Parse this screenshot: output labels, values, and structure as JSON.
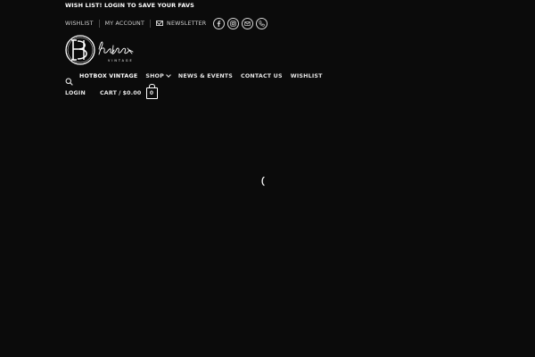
{
  "top_bar": {
    "message": "WISH LIST! LOGIN TO SAVE YOUR FAVS"
  },
  "secondary_nav": {
    "wishlist": "WISHLIST",
    "my_account": "MY ACCOUNT",
    "newsletter": "NEWSLETTER",
    "social_icons": [
      "facebook-icon",
      "instagram-icon",
      "email-icon",
      "phone-icon"
    ]
  },
  "logo": {
    "icon": "hotbox-vintage-monogram-logo"
  },
  "main_nav": {
    "items": [
      {
        "label": "HOTBOX VINTAGE"
      },
      {
        "label": "SHOP"
      },
      {
        "label": "NEWS & EVENTS"
      },
      {
        "label": "CONTACT US"
      },
      {
        "label": "WISHLIST"
      }
    ]
  },
  "account": {
    "login": "LOGIN",
    "cart_label": "CART",
    "cart_separator": "/",
    "cart_total": "$0.00",
    "cart_count": "0"
  },
  "colors": {
    "background": "#0b0b0b",
    "text": "#ffffff",
    "muted_text": "#cfcfcf"
  }
}
